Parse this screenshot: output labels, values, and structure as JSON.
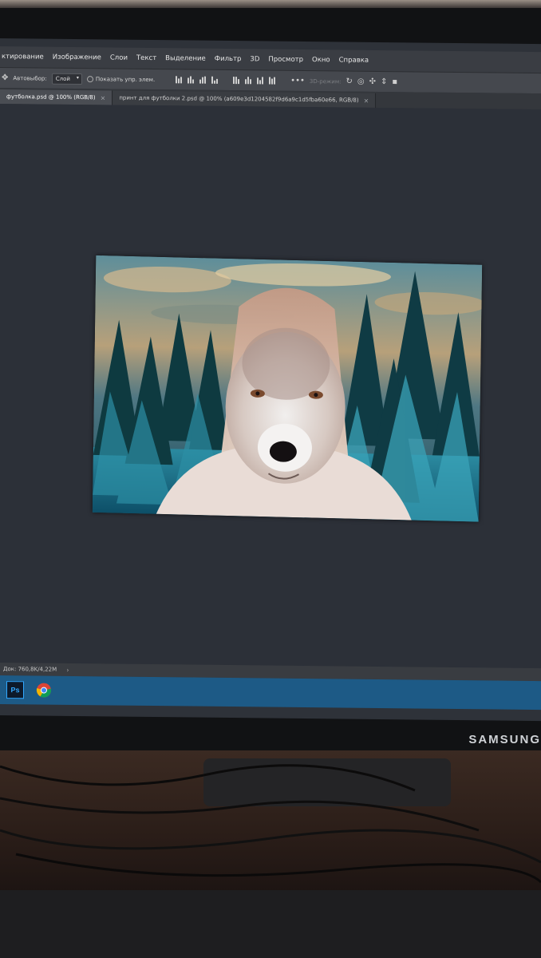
{
  "menu": {
    "items": [
      "ктирование",
      "Изображение",
      "Слои",
      "Текст",
      "Выделение",
      "Фильтр",
      "3D",
      "Просмотр",
      "Окно",
      "Справка"
    ]
  },
  "options_bar": {
    "autoselect_label": "Автовыбор:",
    "autoselect_value": "Слой",
    "show_controls_label": "Показать упр. элем.",
    "mode_3d_label": "3D-режим:"
  },
  "tabs": [
    {
      "label": "футболка.psd @ 100% (RGB/8)",
      "active": true
    },
    {
      "label": "принт для футболки 2.psd @ 100% (a609e3d1204582f9d6a9c1d5fba60e66, RGB/8)",
      "active": false
    }
  ],
  "status": {
    "doc_size": "Док: 760,8K/4,22M"
  },
  "taskbar": {
    "apps": [
      "photoshop-app",
      "chrome-app"
    ],
    "ps_label": "Ps"
  },
  "brand": "SAMSUNG",
  "colors": {
    "accent": "#31a8ff",
    "taskbar": "#1d5a86",
    "workspace": "#2c3038"
  }
}
